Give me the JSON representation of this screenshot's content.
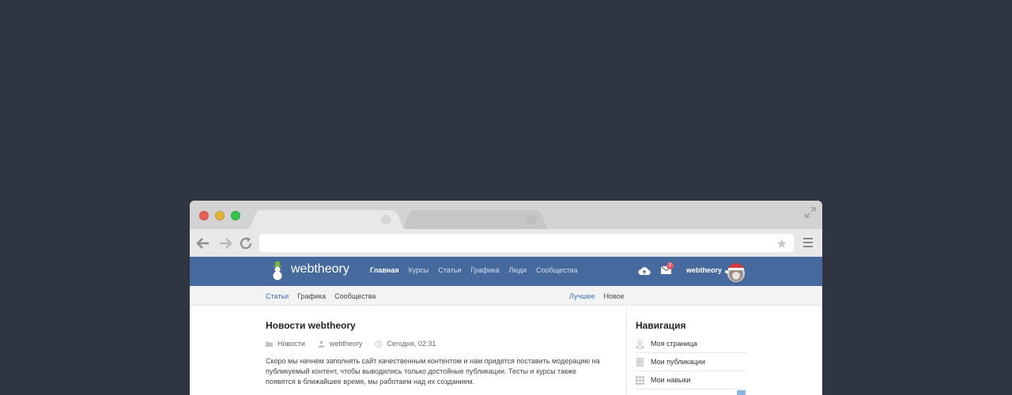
{
  "browser": {
    "address_value": ""
  },
  "site": {
    "brand": "webtheory",
    "nav": [
      "Главная",
      "Курсы",
      "Статьи",
      "Графика",
      "Люди",
      "Сообщества"
    ],
    "mail_badge": "2",
    "username": "webtheory"
  },
  "subnav": {
    "left": [
      "Статьи",
      "Графика",
      "Сообщества"
    ],
    "right": [
      "Лучшее",
      "Новое"
    ]
  },
  "post": {
    "title": "Новости webtheory",
    "category": "Новости",
    "author": "webtheory",
    "date": "Сегодня, 02:31",
    "text": "Скоро мы начнем заполнять сайт качественным контентом и нам придется поставить модерацию на публикуемый контент, чтобы выводились только достойные публикации. Тесты и курсы также появятся в ближайшее время, мы работаем над их созданием."
  },
  "sidebar": {
    "title": "Навигация",
    "items": [
      "Моя страница",
      "Мои публикации",
      "Мои навыки"
    ]
  },
  "colors": {
    "page_bg": "#2f3541",
    "navbar": "#466a9e",
    "link_active": "#3b6eb1"
  }
}
